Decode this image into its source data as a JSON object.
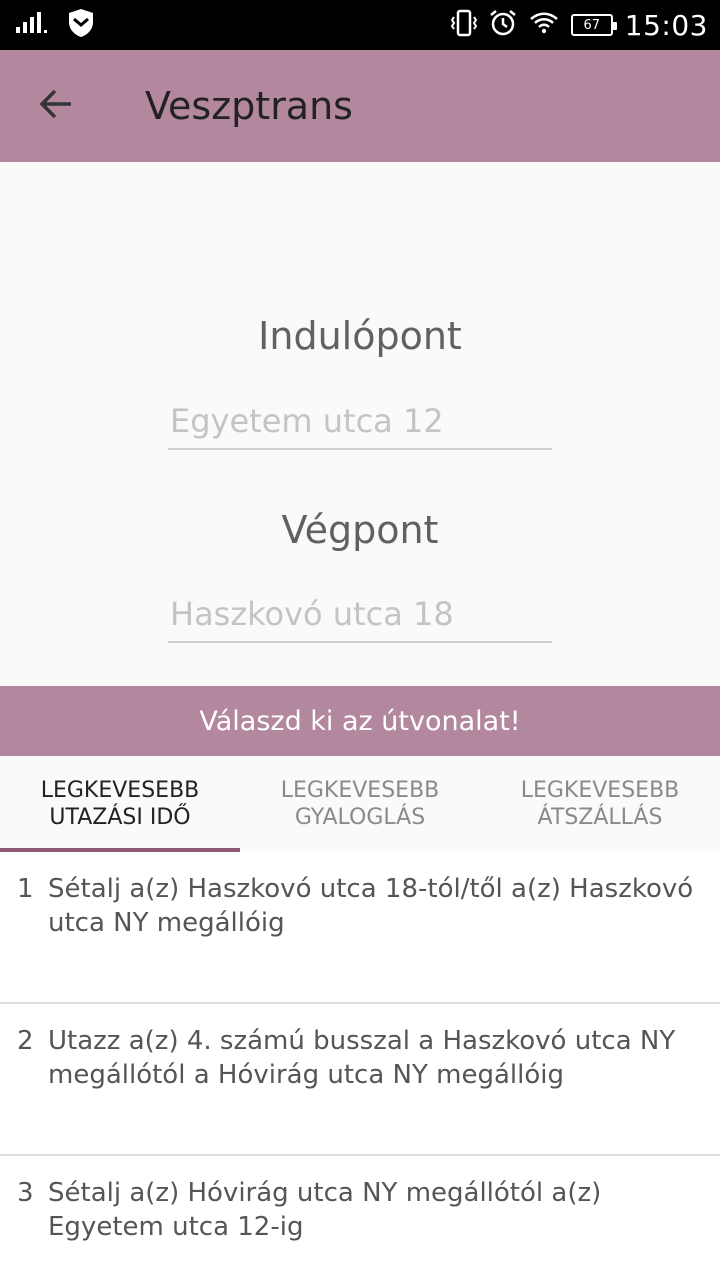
{
  "status_bar": {
    "time": "15:03",
    "battery_level": "67",
    "icons": [
      "signal-icon",
      "shield-icon",
      "vibrate-icon",
      "alarm-icon",
      "wifi-icon",
      "battery-icon"
    ]
  },
  "app_bar": {
    "title": "Veszptrans",
    "back_icon": "arrow-left-icon"
  },
  "form": {
    "start_label": "Indulópont",
    "start_placeholder": "Egyetem utca 12",
    "end_label": "Végpont",
    "end_placeholder": "Haszkovó utca 18"
  },
  "route_prompt": "Válaszd ki az útvonalat!",
  "tabs": [
    {
      "line1": "LEGKEVESEBB",
      "line2": "UTAZÁSI IDŐ",
      "selected": true
    },
    {
      "line1": "LEGKEVESEBB",
      "line2": "GYALOGLÁS",
      "selected": false
    },
    {
      "line1": "LEGKEVESEBB",
      "line2": "ÁTSZÁLLÁS",
      "selected": false
    }
  ],
  "steps": [
    {
      "number": "1",
      "text": "Sétalj a(z) Haszkovó utca 18-tól/től a(z) Haszkovó utca NY megállóig"
    },
    {
      "number": "2",
      "text": "Utazz a(z) 4. számú busszal a Haszkovó utca NY megállótól a Hóvirág utca NY megállóig"
    },
    {
      "number": "3",
      "text": "Sétalj a(z) Hóvirág utca NY megállótól a(z) Egyetem utca 12-ig"
    }
  ],
  "colors": {
    "accent": "#b3889f",
    "tab_indicator": "#8e5a75",
    "status_bar": "#000000"
  }
}
